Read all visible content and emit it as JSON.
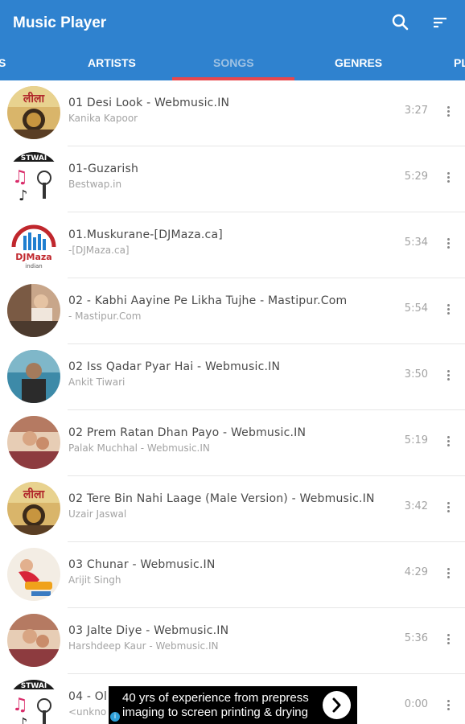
{
  "app": {
    "title": "Music Player",
    "accent": "#2f82cf",
    "indicator_color": "#e8474c",
    "icons": [
      "search-icon",
      "sort-icon"
    ]
  },
  "tabs": [
    {
      "label": "S"
    },
    {
      "label": "ARTISTS"
    },
    {
      "label": "SONGS",
      "active": true
    },
    {
      "label": "GENRES"
    },
    {
      "label": "PL"
    }
  ],
  "songs": [
    {
      "title": "01 Desi Look - Webmusic.IN",
      "artist": "Kanika Kapoor",
      "duration": "3:27",
      "art": "leela"
    },
    {
      "title": "01-Guzarish",
      "artist": "Bestwap.in",
      "duration": "5:29",
      "art": "bestwap"
    },
    {
      "title": "01.Muskurane-[DJMaza.ca]",
      "artist": "-[DJMaza.ca]",
      "duration": "5:34",
      "art": "djmaza"
    },
    {
      "title": "02 - Kabhi Aayine Pe Likha Tujhe - Mastipur.Com",
      "artist": "- Mastipur.Com",
      "duration": "5:54",
      "art": "piano"
    },
    {
      "title": "02 Iss Qadar Pyar Hai - Webmusic.IN",
      "artist": "Ankit Tiwari",
      "duration": "3:50",
      "art": "man"
    },
    {
      "title": "02 Prem Ratan Dhan Payo - Webmusic.IN",
      "artist": "Palak Muchhal - Webmusic.IN",
      "duration": "5:19",
      "art": "movie"
    },
    {
      "title": "02 Tere Bin Nahi Laage (Male Version) - Webmusic.IN",
      "artist": "Uzair Jaswal",
      "duration": "3:42",
      "art": "leela"
    },
    {
      "title": "03 Chunar - Webmusic.IN",
      "artist": "Arijit Singh",
      "duration": "4:29",
      "art": "dance"
    },
    {
      "title": "03 Jalte Diye - Webmusic.IN",
      "artist": "Harshdeep Kaur - Webmusic.IN",
      "duration": "5:36",
      "art": "movie"
    },
    {
      "title": "04 - Ol",
      "artist": "<unkno",
      "duration": "0:00",
      "art": "bestwap"
    }
  ],
  "ad": {
    "line1": "40 yrs of experience from prepress",
    "line2": "imaging to screen printing & drying",
    "info_glyph": "i"
  }
}
